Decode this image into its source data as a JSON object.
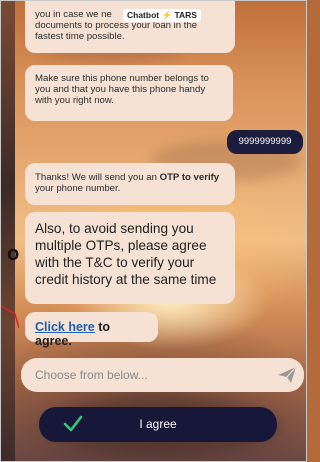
{
  "messages": {
    "bot1_line1_prefix": "you in case we ne",
    "bot1_line2": "documents to process your loan in the",
    "bot1_line3": "fastest time possible.",
    "bot2": "Make sure this phone number belongs to you and that you have this phone handy with you right now.",
    "user_phone": "9999999999",
    "bot3_prefix": "Thanks! We will send you an ",
    "bot3_bold": "OTP to verify",
    "bot3_suffix": " your phone number.",
    "bot4": "Also, to avoid sending you multiple OTPs, please agree with the T&C to verify your credit history at the same time",
    "bot5_link": "Click here",
    "bot5_suffix": " to agree."
  },
  "chip": {
    "label_left": "Chatbot",
    "label_right": "TARS"
  },
  "input": {
    "placeholder": "Choose from below..."
  },
  "agree_button": {
    "label": "I agree"
  },
  "colors": {
    "bubble": "#f5e2d4",
    "user_bubble": "#1c1c3c",
    "button": "#17173a",
    "link": "#1f5fb0",
    "check": "#3cc47a"
  },
  "icons": [
    "send-icon",
    "check-icon",
    "lightning-icon"
  ]
}
